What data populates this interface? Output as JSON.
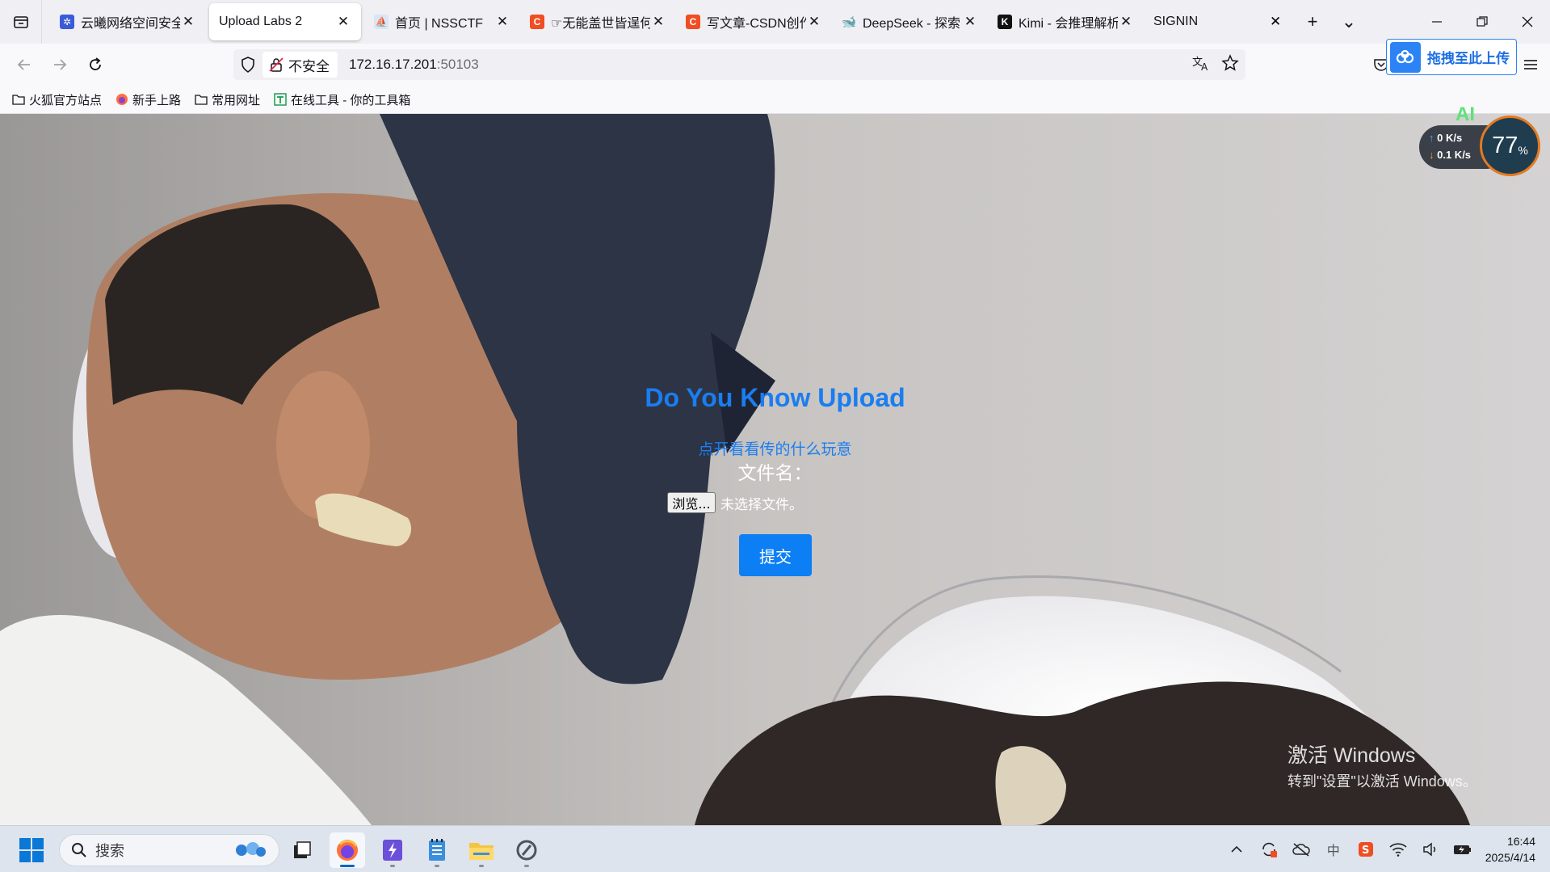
{
  "browser": {
    "tabs": [
      {
        "title": "云曦网络空间安全",
        "favicon": "gear-favicon",
        "active": false
      },
      {
        "title": "Upload Labs 2",
        "favicon": "",
        "active": true
      },
      {
        "title": "首页 | NSSCTF",
        "favicon": "nssctf-favicon",
        "active": false
      },
      {
        "title": "☞无能盖世皆逞何",
        "favicon": "csdn-favicon",
        "active": false
      },
      {
        "title": "写文章-CSDN创作",
        "favicon": "csdn-favicon",
        "active": false
      },
      {
        "title": "DeepSeek - 探索",
        "favicon": "deepseek-favicon",
        "active": false
      },
      {
        "title": "Kimi - 会推理解析",
        "favicon": "kimi-favicon",
        "active": false
      },
      {
        "title": "SIGNIN",
        "favicon": "",
        "active": false
      }
    ],
    "close_glyph": "✕",
    "new_tab_glyph": "+",
    "list_all_glyph": "⌄",
    "url": {
      "security_label": "不安全",
      "host": "172.16.17.201",
      "port": ":50103"
    },
    "upload_extension_label": "拖拽至此上传",
    "bookmarks": [
      {
        "label": "火狐官方站点",
        "icon": "folder-icon"
      },
      {
        "label": "新手上路",
        "icon": "firefox-icon"
      },
      {
        "label": "常用网址",
        "icon": "folder-icon"
      },
      {
        "label": "在线工具 - 你的工具箱",
        "icon": "tool-icon"
      }
    ]
  },
  "page": {
    "title": "Do You Know Upload",
    "subtitle": "点开看看传的什么玩意",
    "file_label": "文件名：",
    "browse_button": "浏览...",
    "no_file_text": "未选择文件。",
    "submit_button": "提交"
  },
  "widget": {
    "upload_speed": "0 K/s",
    "download_speed": "0.1 K/s",
    "percent": "77",
    "percent_unit": "%",
    "ai_badge": "AI"
  },
  "watermark": {
    "line1": "激活 Windows",
    "line2": "转到\"设置\"以激活 Windows。"
  },
  "taskbar": {
    "search_placeholder": "搜索",
    "time": "16:44",
    "date": "2025/4/14",
    "ime_label": "中"
  },
  "colors": {
    "accent": "#1a7df0",
    "submit": "#0d7ff5",
    "upload_ext": "#2b83f6"
  }
}
